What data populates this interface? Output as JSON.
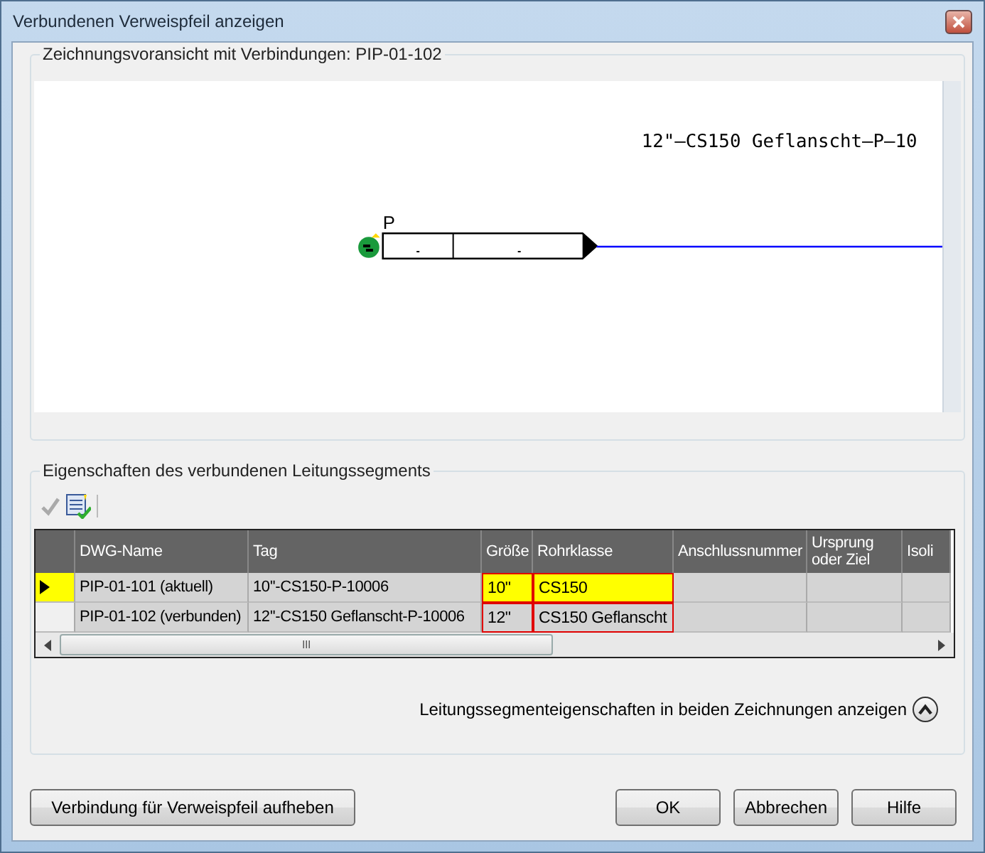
{
  "window": {
    "title": "Verbundenen Verweispfeil anzeigen"
  },
  "preview": {
    "legend": "Zeichnungsvoransicht mit Verbindungen: PIP-01-102",
    "pipe_label": "12\"—CS150  Geflanscht—P—10",
    "tag_letter": "P"
  },
  "properties": {
    "legend": "Eigenschaften des verbundenen Leitungssegments",
    "columns": [
      {
        "label": "DWG-Name",
        "changed": false
      },
      {
        "label": "Tag",
        "changed": false
      },
      {
        "label": "Größe",
        "changed": true
      },
      {
        "label": "Rohrklasse",
        "changed": true
      },
      {
        "label": "Anschlussnummer",
        "changed": false
      },
      {
        "label": "Ursprung oder Ziel",
        "changed": false
      },
      {
        "label": "Isoli",
        "changed": false
      }
    ],
    "rows": [
      {
        "selected": true,
        "cells": [
          "PIP-01-101  (aktuell)",
          "10''-CS150-P-10006",
          "10\"",
          "CS150",
          "",
          "",
          ""
        ]
      },
      {
        "selected": false,
        "cells": [
          "PIP-01-102  (verbunden)",
          "12''-CS150 Geflanscht-P-10006",
          "12\"",
          "CS150 Geflanscht",
          "",
          "",
          ""
        ]
      }
    ],
    "scroll_thumb": "III",
    "toggle_label": "Leitungssegmenteigenschaften in beiden Zeichnungen anzeigen",
    "expanded": true
  },
  "buttons": {
    "left": "Verbindung für Verweispfeil aufheben",
    "right": [
      "OK",
      "Abbrechen",
      "Hilfe"
    ]
  }
}
